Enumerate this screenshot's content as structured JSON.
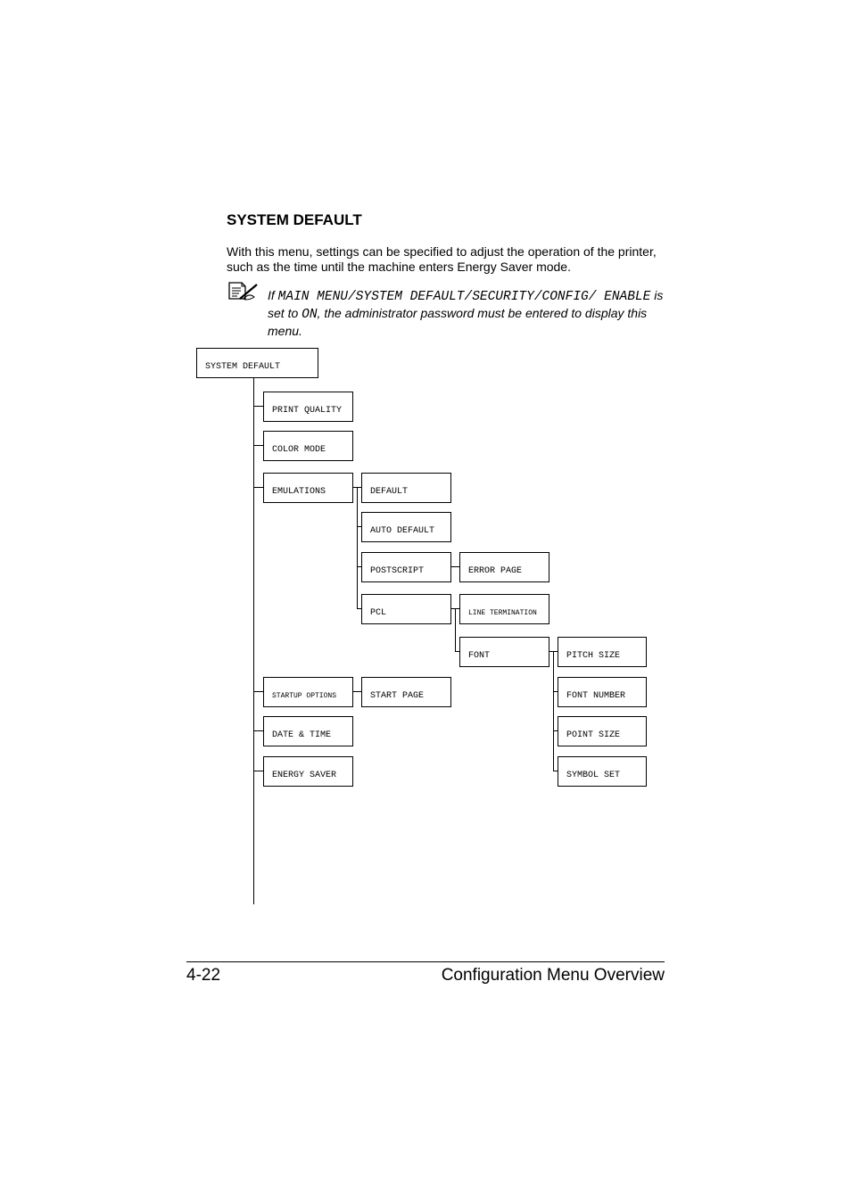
{
  "section": {
    "title": "SYSTEM DEFAULT",
    "intro": "With this menu, settings can be specified to adjust the operation of the printer, such as the time until the machine enters Energy Saver mode.",
    "note": {
      "icon": "note-pencil-icon",
      "prefix": "If ",
      "path": "MAIN MENU/SYSTEM DEFAULT/SECURITY/CONFIG/ ENABLE",
      "mid": " is set to ",
      "value": "ON",
      "suffix": ", the administrator password must be entered to display this menu."
    }
  },
  "menu_tree": {
    "root": "SYSTEM DEFAULT",
    "print_quality": "PRINT QUALITY",
    "color_mode": "COLOR MODE",
    "emulations": "EMULATIONS",
    "default": "DEFAULT",
    "auto_default": "AUTO DEFAULT",
    "postscript": "POSTSCRIPT",
    "error_page": "ERROR PAGE",
    "pcl": "PCL",
    "line_termination": "LINE TERMINATION",
    "font": "FONT",
    "pitch_size": "PITCH SIZE",
    "font_number": "FONT NUMBER",
    "point_size": "POINT SIZE",
    "symbol_set": "SYMBOL SET",
    "startup_options": "STARTUP OPTIONS",
    "start_page": "START PAGE",
    "date_time": "DATE & TIME",
    "energy_saver": "ENERGY SAVER"
  },
  "footer": {
    "page_number": "4-22",
    "chapter_title": "Configuration Menu Overview"
  }
}
